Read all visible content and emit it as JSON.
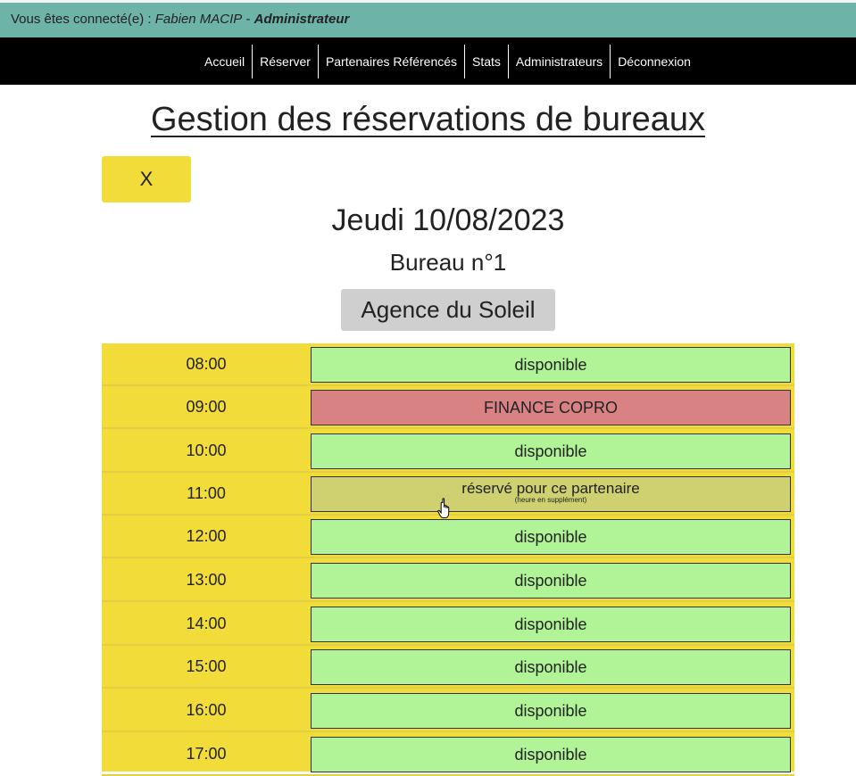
{
  "userbar": {
    "prefix": "Vous êtes connecté(e) : ",
    "name": "Fabien MACIP",
    "sep": " - ",
    "role": "Administrateur"
  },
  "nav": [
    "Accueil",
    "Réserver",
    "Partenaires Référencés",
    "Stats",
    "Administrateurs",
    "Déconnexion"
  ],
  "page": {
    "title": "Gestion des réservations de bureaux",
    "close_label": "X",
    "date": "Jeudi 10/08/2023",
    "bureau": "Bureau n°1",
    "partner": "Agence du Soleil"
  },
  "slots": [
    {
      "time": "08:00",
      "status": "free",
      "label": "disponible"
    },
    {
      "time": "09:00",
      "status": "booked",
      "label": "FINANCE COPRO"
    },
    {
      "time": "10:00",
      "status": "free",
      "label": "disponible"
    },
    {
      "time": "11:00",
      "status": "partner",
      "label": "réservé pour ce partenaire",
      "note": "(heure en supplément)"
    },
    {
      "time": "12:00",
      "status": "free",
      "label": "disponible"
    },
    {
      "time": "13:00",
      "status": "free",
      "label": "disponible"
    },
    {
      "time": "14:00",
      "status": "free",
      "label": "disponible"
    },
    {
      "time": "15:00",
      "status": "free",
      "label": "disponible"
    },
    {
      "time": "16:00",
      "status": "free",
      "label": "disponible"
    },
    {
      "time": "17:00",
      "status": "free",
      "label": "disponible"
    }
  ],
  "colors": {
    "header": "#6eb3a8",
    "accent": "#f1dc3a",
    "free": "#b1f497",
    "booked": "#d88284",
    "partner": "#cfd070"
  }
}
